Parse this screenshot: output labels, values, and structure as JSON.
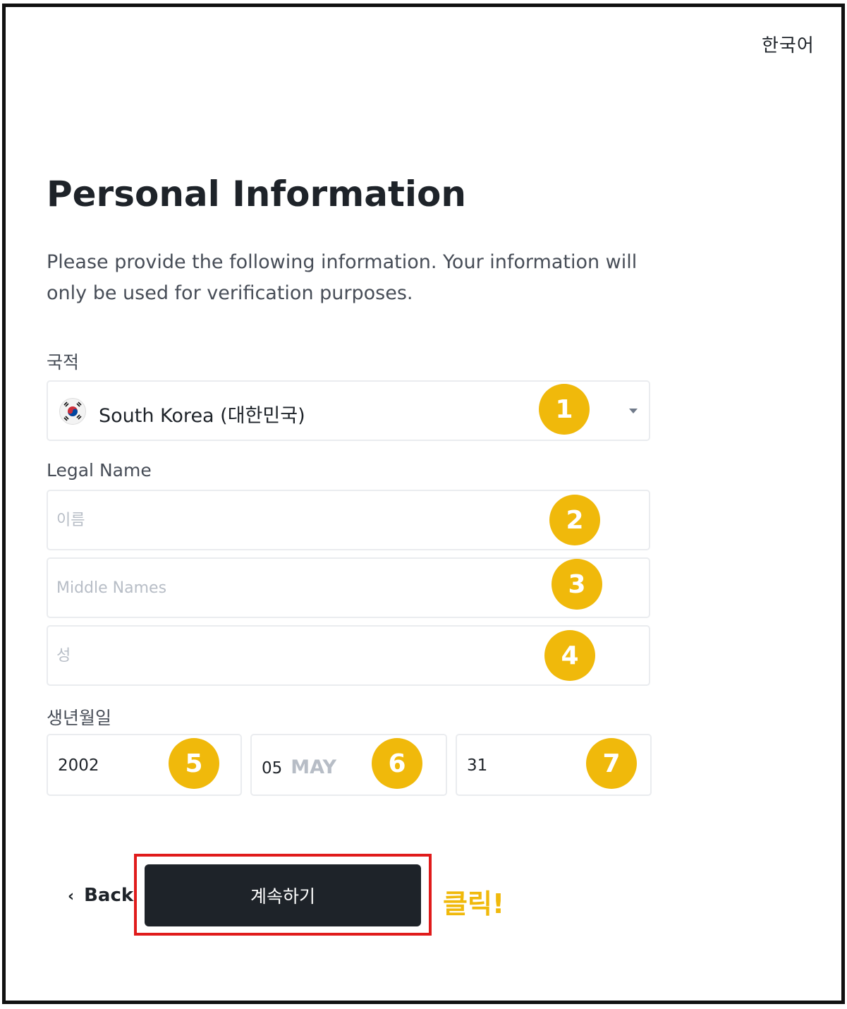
{
  "header": {
    "language": "한국어"
  },
  "page": {
    "title": "Personal Information",
    "description": "Please provide the following information. Your information will only be used for verification purposes."
  },
  "nationality": {
    "label": "국적",
    "value": "South Korea (대한민국)",
    "flag_icon": "south-korea-flag-icon"
  },
  "legal_name": {
    "label": "Legal Name",
    "first_placeholder": "이름",
    "middle_placeholder": "Middle Names",
    "last_placeholder": "성"
  },
  "birth_date": {
    "label": "생년월일",
    "year": "2002",
    "month_number": "05",
    "month_name": "MAY",
    "day": "31"
  },
  "badges": [
    "1",
    "2",
    "3",
    "4",
    "5",
    "6",
    "7"
  ],
  "actions": {
    "back_label": "Back",
    "continue_label": "계속하기",
    "click_note": "클릭!"
  },
  "colors": {
    "badge": "#f0b90b",
    "highlight_border": "#e01b1b",
    "button_bg": "#1e2329"
  }
}
